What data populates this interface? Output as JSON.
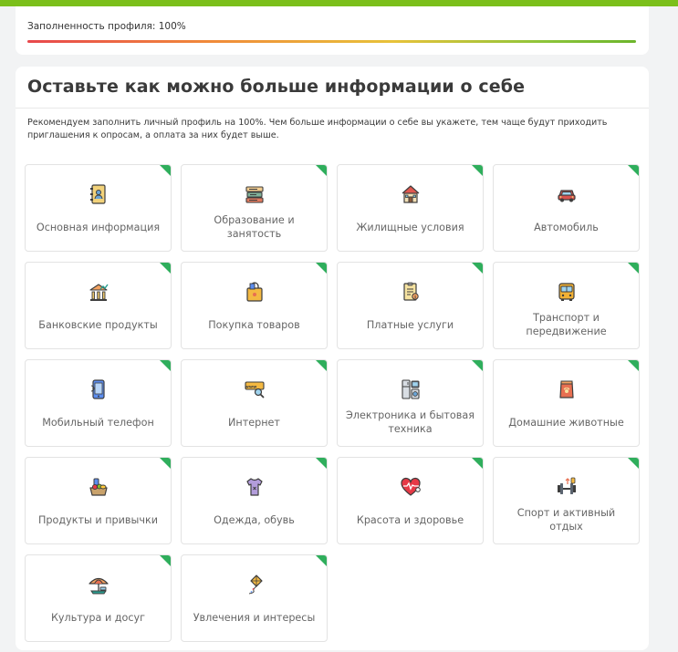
{
  "profile": {
    "completeness_label": "Заполненность профиля: 100%",
    "completeness_fraction": 1.0
  },
  "main": {
    "title": "Оставьте как можно больше информации о себе",
    "description": "Рекомендуем заполнить личный профиль на 100%. Чем больше информации о себе вы укажете, тем чаще будут приходить приглашения к опросам, а оплата за них будет выше."
  },
  "colors": {
    "accent_green": "#2fae5c",
    "top_strip": "#7bbf1a"
  },
  "categories": [
    {
      "label": "Основная информация",
      "icon": "address-book-icon",
      "completed": true
    },
    {
      "label": "Образование и занятость",
      "icon": "books-icon",
      "completed": true
    },
    {
      "label": "Жилищные условия",
      "icon": "house-icon",
      "completed": true
    },
    {
      "label": "Автомобиль",
      "icon": "car-icon",
      "completed": true
    },
    {
      "label": "Банковские продукты",
      "icon": "bank-chart-icon",
      "completed": true
    },
    {
      "label": "Покупка товаров",
      "icon": "shopping-bag-icon",
      "completed": true
    },
    {
      "label": "Платные услуги",
      "icon": "invoice-icon",
      "completed": true
    },
    {
      "label": "Транспорт и передвижение",
      "icon": "bus-icon",
      "completed": true
    },
    {
      "label": "Мобильный телефон",
      "icon": "mobile-phone-icon",
      "completed": true
    },
    {
      "label": "Интернет",
      "icon": "www-search-icon",
      "completed": true
    },
    {
      "label": "Электроника и бытовая техника",
      "icon": "appliances-icon",
      "completed": true
    },
    {
      "label": "Домашние животные",
      "icon": "pet-food-icon",
      "completed": true
    },
    {
      "label": "Продукты и привычки",
      "icon": "groceries-icon",
      "completed": true
    },
    {
      "label": "Одежда, обувь",
      "icon": "tshirt-icon",
      "completed": true
    },
    {
      "label": "Красота и здоровье",
      "icon": "heartbeat-icon",
      "completed": true
    },
    {
      "label": "Спорт и активный отдых",
      "icon": "dumbbell-icon",
      "completed": true
    },
    {
      "label": "Культура и досуг",
      "icon": "beach-umbrella-icon",
      "completed": true
    },
    {
      "label": "Увлечения и интересы",
      "icon": "kite-icon",
      "completed": true
    }
  ]
}
